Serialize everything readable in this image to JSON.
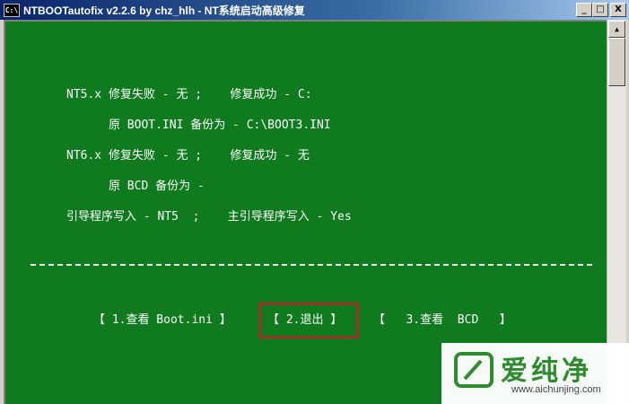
{
  "window": {
    "icon_text": "C:\\",
    "title": "NTBOOTautofix v2.2.6 by chz_hlh - NT系统启动高级修复",
    "minimize_glyph": "_",
    "maximize_glyph": "□",
    "close_glyph": "X"
  },
  "console": {
    "lines": [
      "NT5.x 修复失败 - 无 ;    修复成功 - C:",
      "      原 BOOT.INI 备份为 - C:\\BOOT3.INI",
      "NT6.x 修复失败 - 无 ;    修复成功 - 无",
      "      原 BCD 备份为 -",
      "引导程序写入 - NT5  ;    主引导程序写入 - Yes"
    ],
    "divider": "-----------------------------------------------------------------------------------------------------"
  },
  "menu": {
    "items": [
      {
        "label": "【 1.查看 Boot.ini 】"
      },
      {
        "label": "【 2.退出 】",
        "selected": true
      },
      {
        "label": "【   3.查看  BCD   】"
      }
    ],
    "highlight_color": "#a0322a"
  },
  "scrollbar": {
    "up_glyph": "▲"
  },
  "watermark": {
    "text_cn": "爱纯净",
    "url": "www.aichunjing.com"
  },
  "colors": {
    "console_bg": "#0f7a1e",
    "console_text": "#ffffff",
    "titlebar": "#0a246a"
  }
}
